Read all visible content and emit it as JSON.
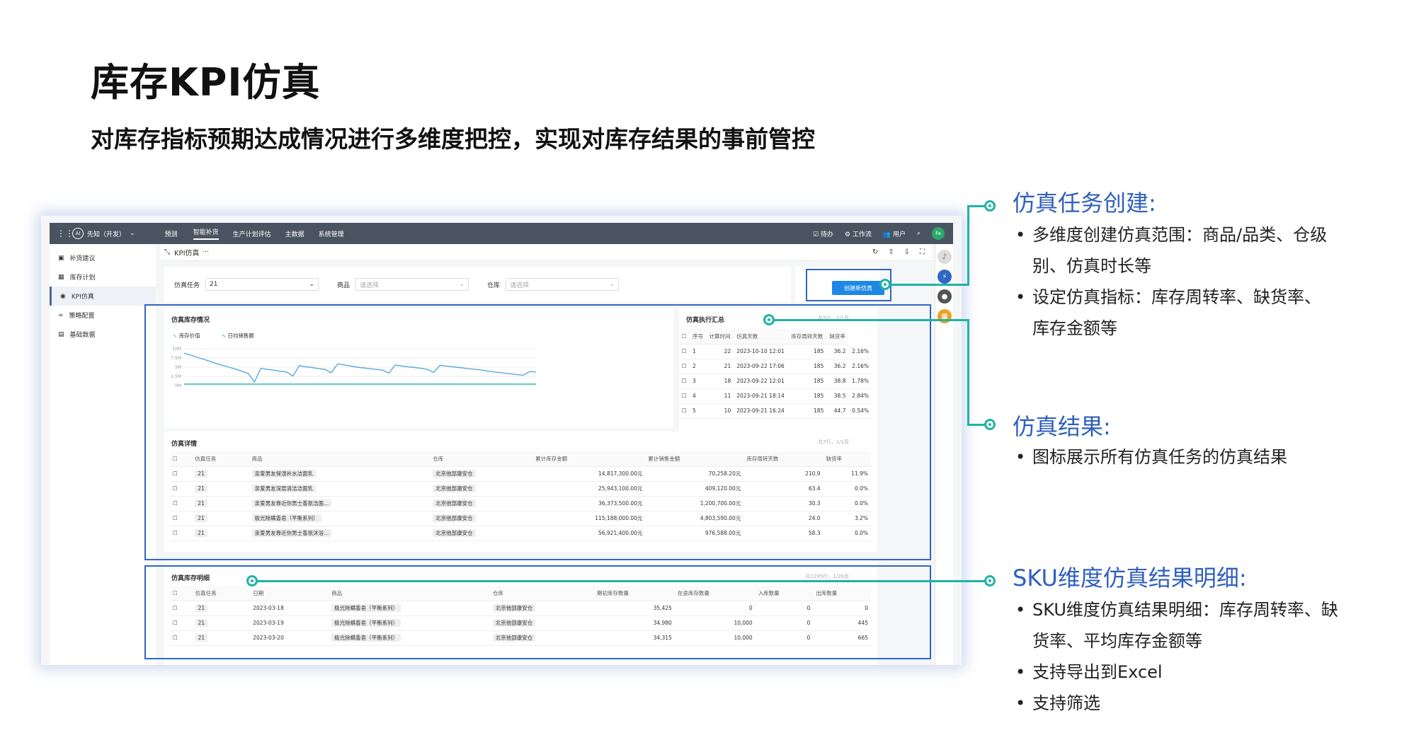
{
  "title": "库存KPI仿真",
  "subtitle": "对库存指标预期达成情况进行多维度把控，实现对库存结果的事前管控",
  "app": {
    "brand": "先知（开发）",
    "nav": [
      "预测",
      "智能补货",
      "生产计划评估",
      "主数据",
      "系统管理"
    ],
    "active_nav": "智能补货",
    "right": [
      "待办",
      "工作流",
      "用户"
    ],
    "avatar": "Fa",
    "sidebar": [
      {
        "label": "补货建议",
        "icon": "truck-icon"
      },
      {
        "label": "库存计划",
        "icon": "grid-icon"
      },
      {
        "label": "KPI仿真",
        "icon": "kpi-icon"
      },
      {
        "label": "策略配置",
        "icon": "link-icon"
      },
      {
        "label": "基础数据",
        "icon": "data-icon"
      }
    ],
    "tab": "KPI仿真",
    "filters": [
      {
        "label": "仿真任务",
        "value": "21"
      },
      {
        "label": "商品",
        "placeholder": "请选择"
      },
      {
        "label": "仓库",
        "placeholder": "请选择"
      }
    ],
    "create_button": "创建新仿真"
  },
  "chart_panel": {
    "title": "仿真库存情况",
    "legend": [
      "库存价值",
      "日均销售额"
    ]
  },
  "chart_data": {
    "type": "line",
    "title": "仿真库存情况",
    "ytick_labels": [
      "10M",
      "7.5M",
      "5M",
      "2.5M",
      "0M"
    ],
    "ylim": [
      0,
      10000000
    ],
    "series": [
      {
        "name": "库存价值",
        "color": "#5aa9e0",
        "values": [
          8.8,
          8.3,
          7.7,
          7.2,
          6.6,
          6.0,
          5.5,
          5.0,
          4.5,
          3.9,
          3.3,
          1.0,
          4.7,
          4.4,
          4.2,
          3.9,
          3.7,
          2.6,
          5.4,
          5.1,
          4.9,
          4.6,
          4.4,
          3.5,
          5.9,
          5.6,
          5.3,
          5.0,
          4.8,
          4.6,
          4.4,
          4.2,
          3.4,
          5.6,
          5.3,
          5.1,
          4.9,
          4.7,
          4.4,
          3.6,
          5.5,
          5.3,
          5.1,
          4.9,
          4.7,
          4.5,
          4.3,
          4.1,
          3.8,
          3.6,
          3.4,
          3.2,
          3.0,
          2.8,
          3.8,
          3.7
        ]
      },
      {
        "name": "日均销售额",
        "color": "#1fb3a6",
        "values": [
          0.4,
          0.4,
          0.4,
          0.4,
          0.4,
          0.4,
          0.4,
          0.4,
          0.4,
          0.4,
          0.4,
          0.4,
          0.4,
          0.4,
          0.4,
          0.4,
          0.4,
          0.4,
          0.4,
          0.4,
          0.4,
          0.4,
          0.4,
          0.4,
          0.4,
          0.4,
          0.4,
          0.4,
          0.4,
          0.4,
          0.4,
          0.4,
          0.4,
          0.4,
          0.4,
          0.4,
          0.4,
          0.4,
          0.4,
          0.4,
          0.4,
          0.4,
          0.4,
          0.4,
          0.4,
          0.4,
          0.4,
          0.4,
          0.4,
          0.4,
          0.4,
          0.4,
          0.4,
          0.4,
          0.4,
          0.4
        ]
      }
    ],
    "unit": "M"
  },
  "summary": {
    "title": "仿真执行汇总",
    "pager": "共5行，1/1页",
    "headers": [
      "序号",
      "计算时间",
      "仿真天数",
      "库存周转天数",
      "缺货率"
    ],
    "rows": [
      [
        "1",
        "22",
        "2023-10-10 12:01",
        "185",
        "36.2",
        "2.16%"
      ],
      [
        "2",
        "21",
        "2023-09-22 17:06",
        "185",
        "36.2",
        "2.16%"
      ],
      [
        "3",
        "18",
        "2023-09-22 12:01",
        "185",
        "38.8",
        "1.78%"
      ],
      [
        "4",
        "11",
        "2023-09-21 18:14",
        "185",
        "38.5",
        "2.84%"
      ],
      [
        "5",
        "10",
        "2023-09-21 16:24",
        "185",
        "44.7",
        "0.54%"
      ]
    ]
  },
  "detail": {
    "title": "仿真详情",
    "pager": "共7行，1/1页",
    "headers": [
      "仿真任务",
      "商品",
      "仓库",
      "累计库存金额",
      "累计销售金额",
      "库存周转天数",
      "缺货率"
    ],
    "rows": [
      [
        "21",
        "亲爱男友保湿补水洁面乳",
        "北京他部康安仓",
        "14,817,300.00元",
        "70,258.20元",
        "210.9",
        "11.9%"
      ],
      [
        "21",
        "亲爱男友深层清洁洁面乳",
        "北京他部康安仓",
        "25,943,100.00元",
        "409,120.00元",
        "63.4",
        "0.0%"
      ],
      [
        "21",
        "亲爱男友靠近你男士香氛洁面...",
        "北京他部康安仓",
        "36,373,500.00元",
        "1,200,700.00元",
        "30.3",
        "0.0%"
      ],
      [
        "21",
        "极光除螨香皂（平衡系列）",
        "北京他部康安仓",
        "115,188,000.00元",
        "4,803,590.00元",
        "24.0",
        "3.2%"
      ],
      [
        "21",
        "亲爱男友靠近你男士香氛沐浴...",
        "北京他部康安仓",
        "56,921,400.00元",
        "976,588.00元",
        "58.3",
        "0.0%"
      ]
    ]
  },
  "sku": {
    "title": "仿真库存明细",
    "pager": "共1295行，1/26页",
    "headers": [
      "仿真任务",
      "日期",
      "商品",
      "仓库",
      "期初库存数量",
      "在途库存数量",
      "入库数量",
      "出库数量"
    ],
    "rows": [
      [
        "21",
        "2023-03-18",
        "极光除螨香皂（平衡系列）",
        "北京他部康安仓",
        "35,425",
        "0",
        "0",
        "0"
      ],
      [
        "21",
        "2023-03-19",
        "极光除螨香皂（平衡系列）",
        "北京他部康安仓",
        "34,980",
        "10,000",
        "0",
        "445"
      ],
      [
        "21",
        "2023-03-20",
        "极光除螨香皂（平衡系列）",
        "北京他部康安仓",
        "34,315",
        "10,000",
        "0",
        "665"
      ]
    ]
  },
  "annotations": [
    {
      "heading": "仿真任务创建:",
      "bullets": [
        "多维度创建仿真范围：商品/品类、仓级",
        "别、仿真时长等",
        "设定仿真指标：库存周转率、缺货率、",
        "库存金额等"
      ]
    },
    {
      "heading": "仿真结果:",
      "bullets": [
        "图标展示所有仿真任务的仿真结果"
      ]
    },
    {
      "heading": "SKU维度仿真结果明细:",
      "bullets": [
        "SKU维度仿真结果明细：库存周转率、缺",
        "货率、平均库存金额等",
        "支持导出到Excel",
        "支持筛选"
      ]
    }
  ]
}
